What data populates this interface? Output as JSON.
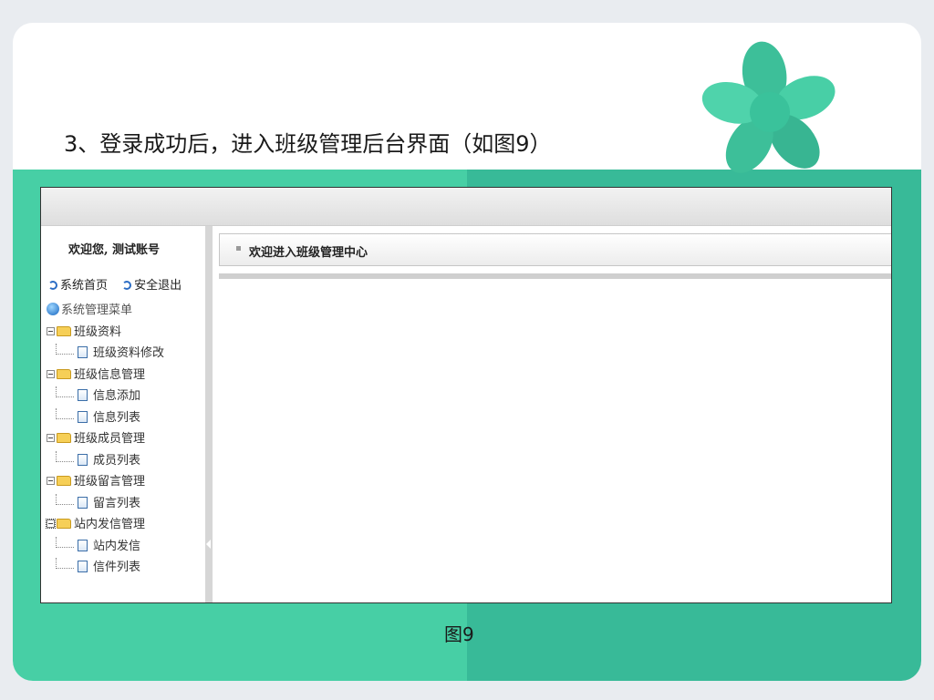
{
  "slide": {
    "heading": "3、登录成功后，进入班级管理后台界面（如图9）",
    "caption": "图9"
  },
  "app": {
    "welcome": "欢迎您, 测试账号",
    "links": [
      "系统首页",
      "安全退出"
    ],
    "menu_title": "系统管理菜单",
    "menu": [
      {
        "label": "班级资料",
        "children": [
          "班级资料修改"
        ]
      },
      {
        "label": "班级信息管理",
        "children": [
          "信息添加",
          "信息列表"
        ]
      },
      {
        "label": "班级成员管理",
        "children": [
          "成员列表"
        ]
      },
      {
        "label": "班级留言管理",
        "children": [
          "留言列表"
        ]
      },
      {
        "label": "站内发信管理",
        "children": [
          "站内发信",
          "信件列表"
        ]
      }
    ],
    "main_title": "欢迎进入班级管理中心"
  },
  "colors": {
    "band_left": "#47cfa5",
    "band_right": "#38ba98",
    "leaf_green": "#3dbf99"
  }
}
